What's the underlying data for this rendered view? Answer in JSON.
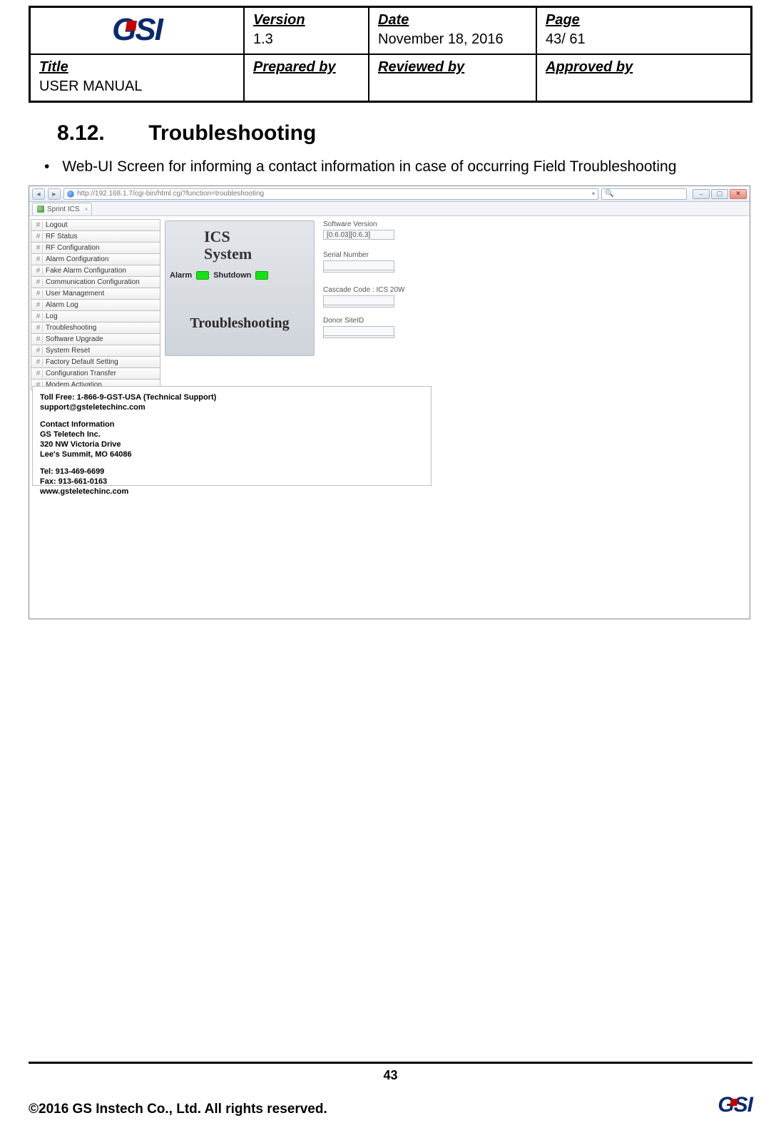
{
  "doc": {
    "logo_text": "GSI",
    "version_label": "Version",
    "version_value": "1.3",
    "date_label": "Date",
    "date_value": "November 18, 2016",
    "page_label": "Page",
    "page_value": "43/ 61",
    "title_label": "Title",
    "title_value": "USER MANUAL",
    "prepared_label": "Prepared by",
    "reviewed_label": "Reviewed by",
    "approved_label": "Approved by"
  },
  "section": {
    "number": "8.12.",
    "title": "Troubleshooting",
    "bullet": "Web-UI Screen for informing a contact information in case of occurring Field Troubleshooting"
  },
  "browser": {
    "url": "http://192.168.1.7/cgi-bin/html.cgi?function=troubleshooting",
    "search_icon": "🔍",
    "tab_title": "Sprint ICS"
  },
  "nav_items": [
    "Logout",
    "RF Status",
    "RF Configuration",
    "Alarm Configuration",
    "Fake Alarm Configuration",
    "Communication Configuration",
    "User Management",
    "Alarm Log",
    "Log",
    "Troubleshooting",
    "Software Upgrade",
    "System Reset",
    "Factory Default Setting",
    "Configuration Transfer",
    "Modem Activation"
  ],
  "center": {
    "title_line1": "ICS",
    "title_line2": "System",
    "alarm_label": "Alarm",
    "shutdown_label": "Shutdown",
    "page_name": "Troubleshooting"
  },
  "info": {
    "sw_label": "Software Version",
    "sw_value": "[0.6.03][0.6.3]",
    "sn_label": "Serial Number",
    "sn_value": "",
    "cascade_label": "Cascade Code : ICS 20W",
    "cascade_value": "",
    "donor_label": "Donor SiteID",
    "donor_value": ""
  },
  "contact": {
    "line1": "Toll Free: 1-866-9-GST-USA (Technical Support)",
    "line2": "support@gsteletechinc.com",
    "h1": "Contact Information",
    "h2": "GS Teletech Inc.",
    "h3": "320 NW Victoria Drive",
    "h4": "Lee's Summit, MO 64086",
    "t1": "Tel: 913-469-6699",
    "t2": "Fax: 913-661-0163",
    "t3": "www.gsteletechinc.com"
  },
  "footer": {
    "page_number": "43",
    "copyright": "©2016 GS Instech Co., Ltd.   All rights reserved.",
    "logo_text": "GSI"
  }
}
